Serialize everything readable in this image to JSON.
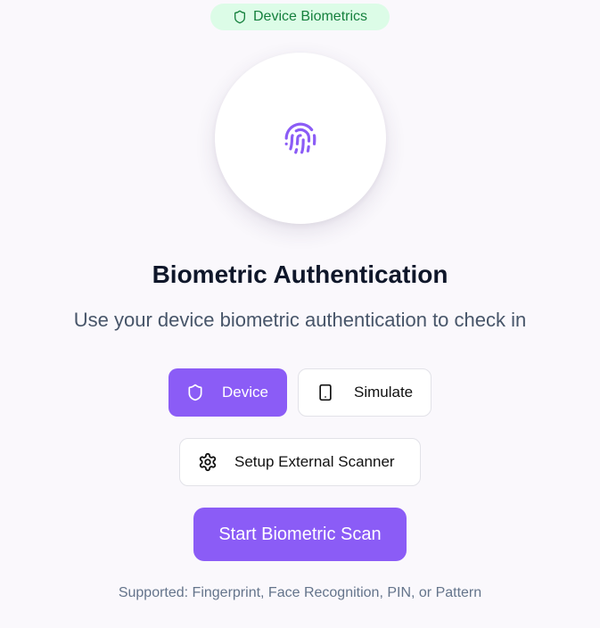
{
  "badge": {
    "label": "Device Biometrics",
    "icon": "shield-icon",
    "color": "#15803d",
    "background": "#dcfce7"
  },
  "hero": {
    "icon": "fingerprint-icon",
    "accent": "#8b5cf6"
  },
  "heading": {
    "title": "Biometric Authentication",
    "subtitle": "Use your device biometric authentication to check in"
  },
  "modes": {
    "device": {
      "label": "Device",
      "icon": "shield-icon",
      "selected": true
    },
    "simulate": {
      "label": "Simulate",
      "icon": "smartphone-icon",
      "selected": false
    }
  },
  "scanner": {
    "label": "Setup External Scanner",
    "icon": "gear-icon"
  },
  "start": {
    "label": "Start Biometric Scan"
  },
  "footer": {
    "supported": "Supported: Fingerprint, Face Recognition, PIN, or Pattern"
  },
  "colors": {
    "primary": "#8b5cf6",
    "background": "#faf8fc",
    "title": "#0f172a",
    "muted": "#64748b"
  }
}
